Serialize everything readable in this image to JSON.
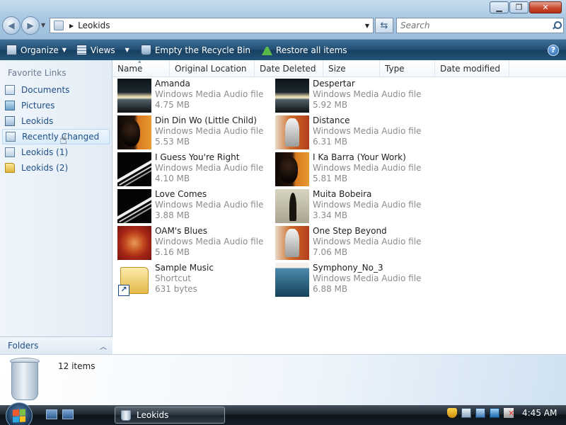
{
  "window": {
    "minimize_symbol": "▁",
    "maximize_symbol": "❐",
    "close_symbol": "✕"
  },
  "address": {
    "path": "Leokids",
    "search_placeholder": "Search"
  },
  "toolbar": {
    "organize": "Organize",
    "views": "Views",
    "empty": "Empty the Recycle Bin",
    "restore": "Restore all items",
    "help": "?"
  },
  "nav": {
    "heading": "Favorite Links",
    "items": [
      {
        "label": "Documents",
        "icon": "documents-icon"
      },
      {
        "label": "Pictures",
        "icon": "pictures-icon"
      },
      {
        "label": "Leokids",
        "icon": "user-icon"
      },
      {
        "label": "Recently Changed",
        "icon": "recently-changed-icon"
      },
      {
        "label": "Leokids (1)",
        "icon": "recently-changed-icon"
      },
      {
        "label": "Leokids (2)",
        "icon": "folder-icon"
      }
    ],
    "folders": "Folders"
  },
  "columns": [
    "Name",
    "Original Location",
    "Date Deleted",
    "Size",
    "Type",
    "Date modified"
  ],
  "files": [
    {
      "name": "Amanda",
      "type": "Windows Media Audio file",
      "size": "4.75 MB",
      "art": "amanda"
    },
    {
      "name": "Din Din Wo (Little Child)",
      "type": "Windows Media Audio file",
      "size": "5.53 MB",
      "art": "dindin"
    },
    {
      "name": "I Guess You're Right",
      "type": "Windows Media Audio file",
      "size": "4.10 MB",
      "art": "guess"
    },
    {
      "name": "Love Comes",
      "type": "Windows Media Audio file",
      "size": "3.88 MB",
      "art": "guess"
    },
    {
      "name": "OAM's Blues",
      "type": "Windows Media Audio file",
      "size": "5.16 MB",
      "art": "oam"
    },
    {
      "name": "Sample Music",
      "type": "Shortcut",
      "size": "631 bytes",
      "art": "sample"
    },
    {
      "name": "Despertar",
      "type": "Windows Media Audio file",
      "size": "5.92 MB",
      "art": "amanda"
    },
    {
      "name": "Distance",
      "type": "Windows Media Audio file",
      "size": "6.31 MB",
      "art": "distance"
    },
    {
      "name": "I Ka Barra (Your Work)",
      "type": "Windows Media Audio file",
      "size": "5.81 MB",
      "art": "dindin"
    },
    {
      "name": "Muita Bobeira",
      "type": "Windows Media Audio file",
      "size": "3.34 MB",
      "art": "muita"
    },
    {
      "name": "One Step Beyond",
      "type": "Windows Media Audio file",
      "size": "7.06 MB",
      "art": "distance"
    },
    {
      "name": "Symphony_No_3",
      "type": "Windows Media Audio file",
      "size": "6.88 MB",
      "art": "symph"
    }
  ],
  "details": {
    "count": "12 items"
  },
  "taskbar": {
    "window_label": "Leokids",
    "clock": "4:45 AM"
  }
}
